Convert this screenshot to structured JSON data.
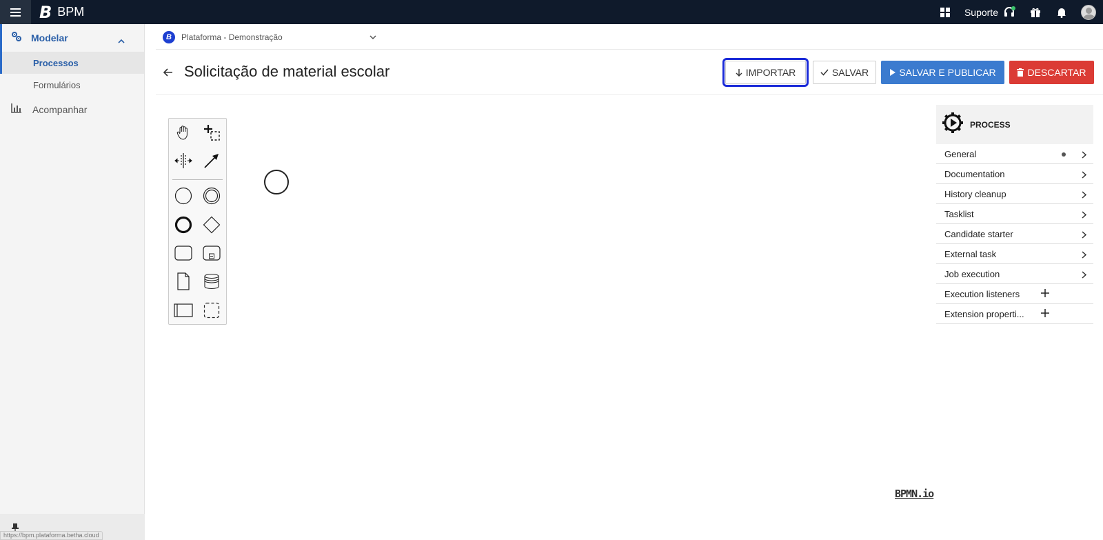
{
  "app": {
    "brand_logo": "B",
    "brand_name": "BPM"
  },
  "topbar": {
    "support_label": "Suporte",
    "icons": [
      "apps-grid-icon",
      "headset-icon",
      "gift-icon",
      "bell-icon",
      "avatar"
    ]
  },
  "sidebar": {
    "sections": [
      {
        "label": "Modelar",
        "icon": "gears-icon",
        "expanded": true,
        "items": [
          {
            "label": "Processos",
            "selected": true
          },
          {
            "label": "Formulários",
            "selected": false
          }
        ]
      },
      {
        "label": "Acompanhar",
        "icon": "bar-chart-icon"
      }
    ],
    "status_url": "https://bpm.plataforma.betha.cloud"
  },
  "header": {
    "platform_logo": "B",
    "platform_name": "Plataforma - Demonstração",
    "title": "Solicitação de material escolar",
    "buttons": {
      "import": "IMPORTAR",
      "save": "SALVAR",
      "save_publish": "SALVAR E PUBLICAR",
      "discard": "DESCARTAR"
    }
  },
  "colors": {
    "topbar": "#0f1a2b",
    "accent": "#3b7bcf",
    "danger": "#db3b35",
    "focus_outline": "#1b2bd8"
  },
  "canvas": {
    "palette_tools": [
      "hand-tool-icon",
      "lasso-tool-icon",
      "space-tool-icon",
      "connect-tool-icon",
      "start-event-icon",
      "intermediate-event-icon",
      "end-event-icon",
      "gateway-icon",
      "task-icon",
      "subprocess-icon",
      "data-object-icon",
      "data-store-icon",
      "pool-icon",
      "group-icon"
    ],
    "bpmn_logo": "BPMN.io"
  },
  "properties": {
    "header": "PROCESS",
    "rows": [
      {
        "label": "General",
        "kind": "chevron",
        "dot": true
      },
      {
        "label": "Documentation",
        "kind": "chevron"
      },
      {
        "label": "History cleanup",
        "kind": "chevron"
      },
      {
        "label": "Tasklist",
        "kind": "chevron"
      },
      {
        "label": "Candidate starter",
        "kind": "chevron"
      },
      {
        "label": "External task",
        "kind": "chevron"
      },
      {
        "label": "Job execution",
        "kind": "chevron"
      },
      {
        "label": "Execution listeners",
        "kind": "plus"
      },
      {
        "label": "Extension properti...",
        "kind": "plus"
      }
    ]
  }
}
